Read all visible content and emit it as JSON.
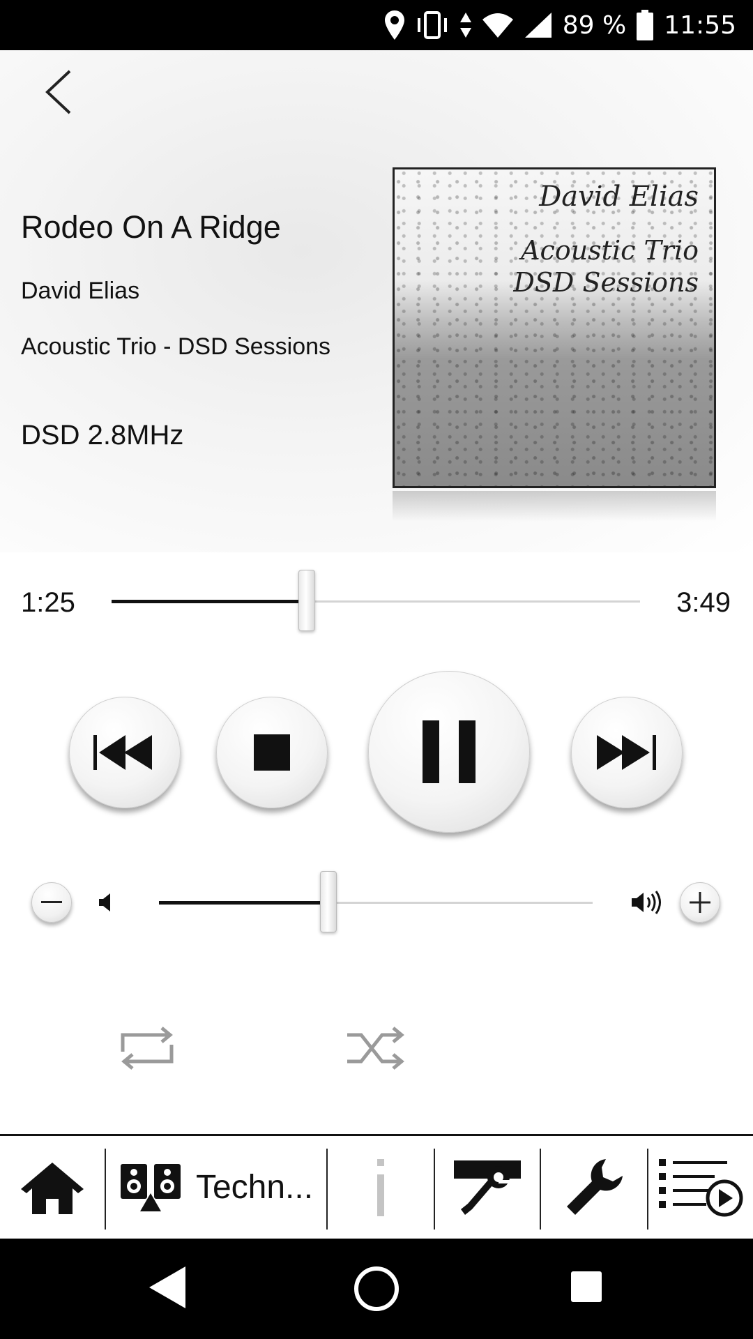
{
  "status_bar": {
    "battery": "89 %",
    "time": "11:55",
    "icons": [
      "location-icon",
      "vibrate-icon",
      "data-arrows-icon",
      "wifi-icon",
      "cell-signal-icon",
      "battery-icon"
    ]
  },
  "now_playing": {
    "title": "Rodeo On A Ridge",
    "artist": "David Elias",
    "album": "Acoustic Trio - DSD Sessions",
    "format": "DSD 2.8MHz",
    "cover": {
      "artist": "David Elias",
      "line1": "Acoustic Trio",
      "line2": "DSD Sessions"
    }
  },
  "progress": {
    "elapsed": "1:25",
    "total": "3:49",
    "fraction": 0.37
  },
  "volume": {
    "fraction": 0.39
  },
  "bottom_nav": {
    "device_label": "Techn..."
  },
  "colors": {
    "accent": "#111111",
    "track": "#d4d4d4",
    "muted_icon": "#9a9a9a"
  }
}
